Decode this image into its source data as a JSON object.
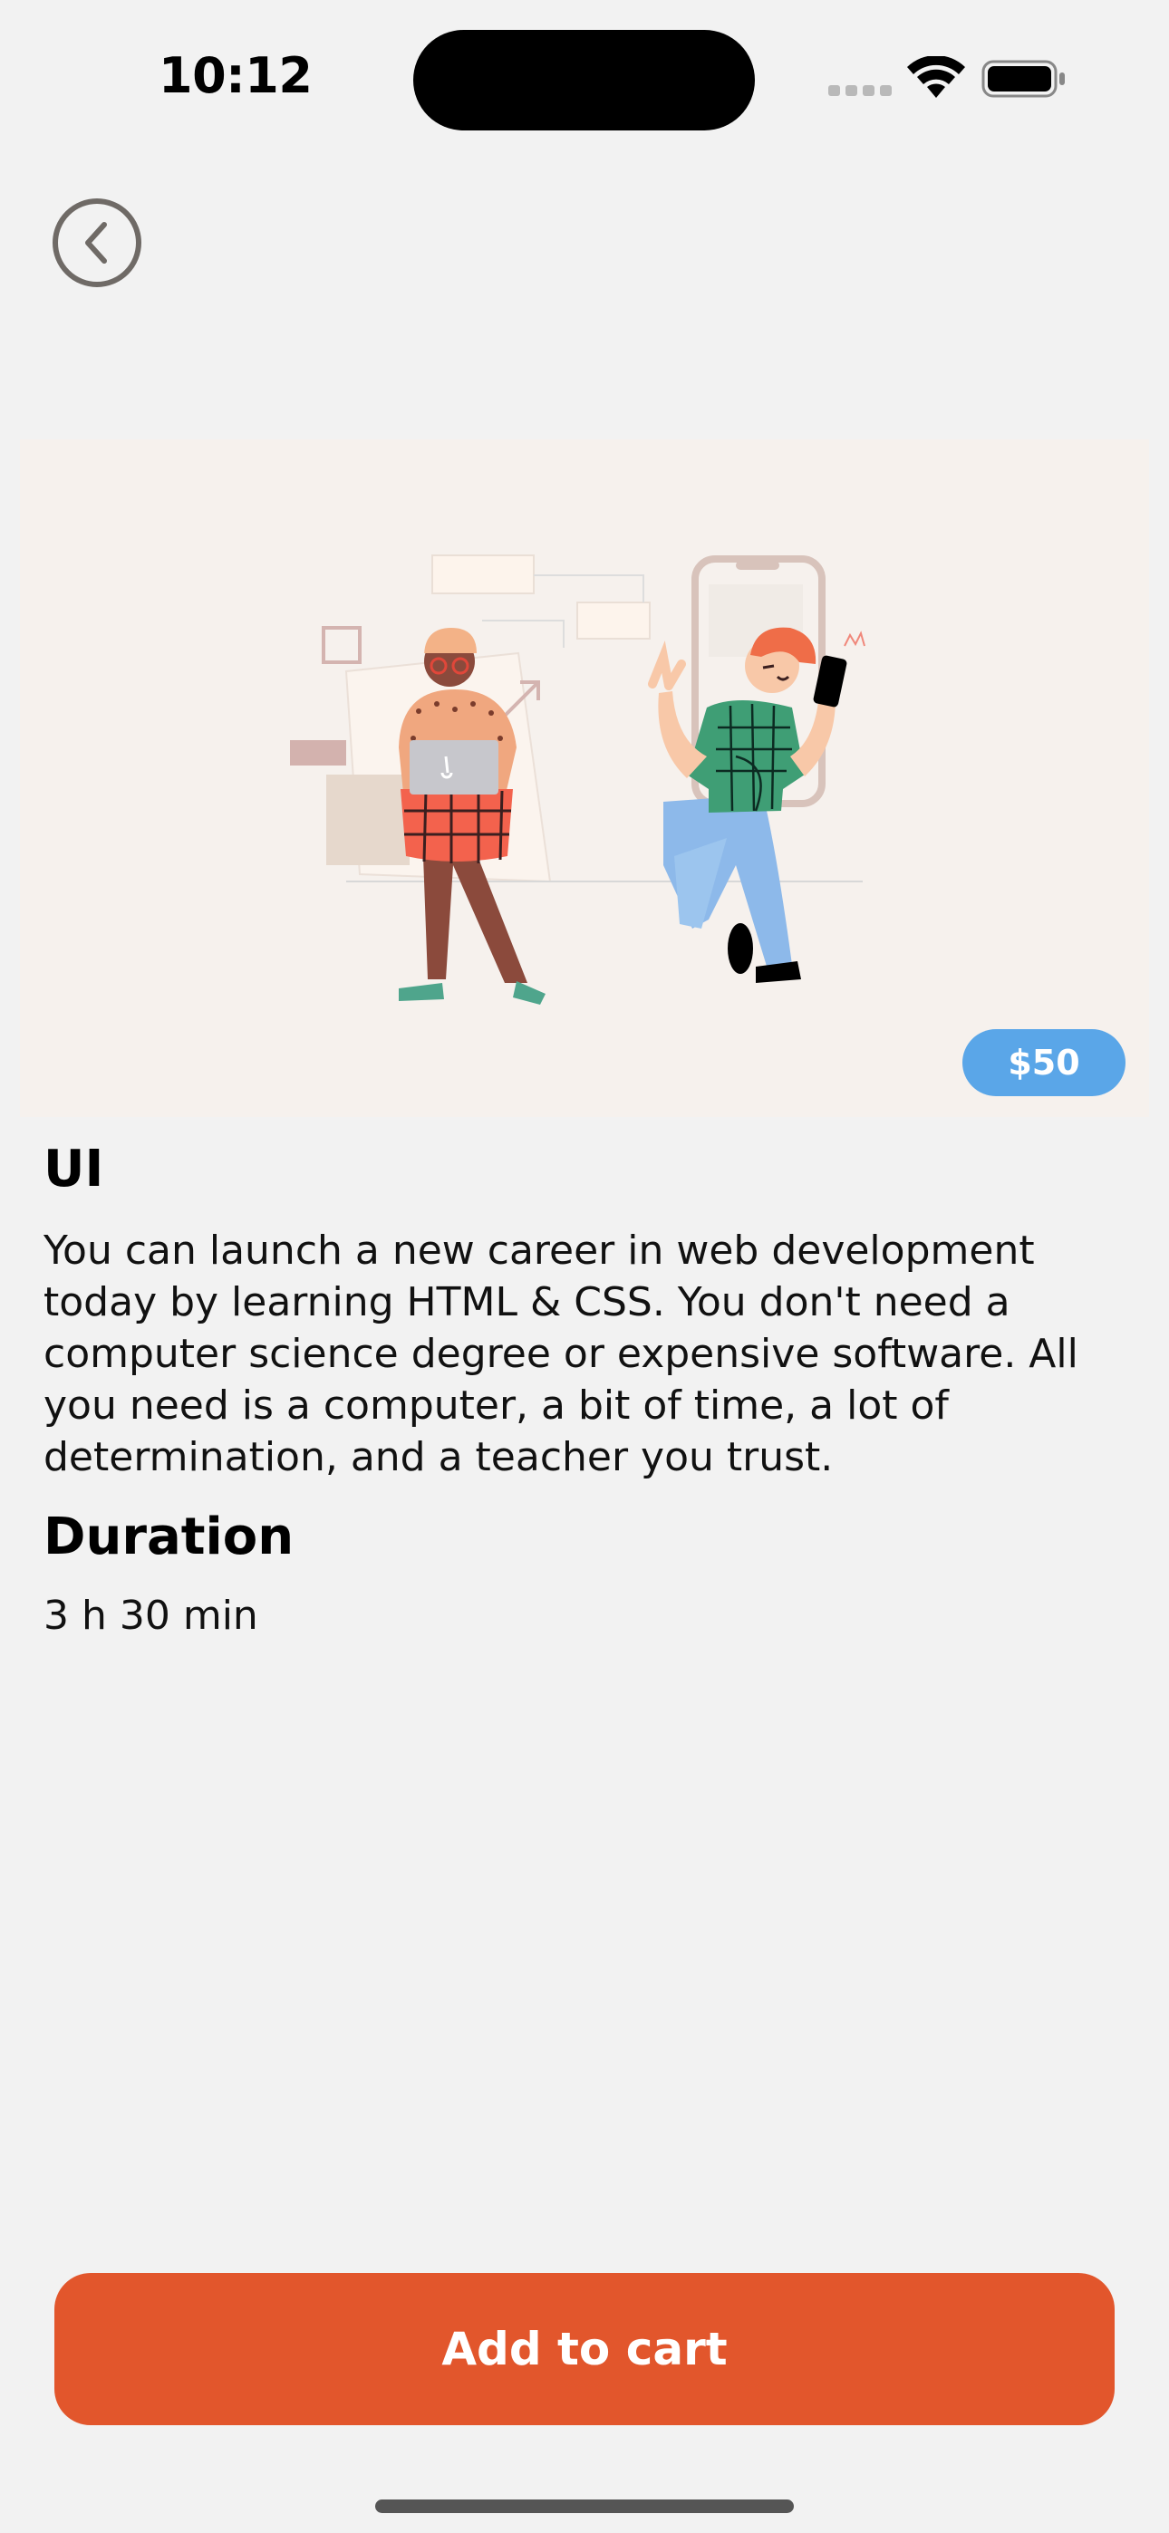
{
  "status_bar": {
    "time": "10:12",
    "icons": [
      "cellular-signal-icon",
      "wifi-icon",
      "battery-icon"
    ]
  },
  "navigation": {
    "back_icon": "chevron-left-icon"
  },
  "hero": {
    "illustration": "two-people-learning-illustration",
    "price": "$50",
    "price_color": "#5aa6e8"
  },
  "course": {
    "title": "UI",
    "description": "You can launch a new career in web development today by learning HTML & CSS. You don't need a computer science degree or expensive software. All you need is a computer, a bit of time, a lot of determination, and a teacher you trust.",
    "duration_heading": "Duration",
    "duration_value": "3 h 30 min"
  },
  "actions": {
    "add_to_cart_label": "Add to cart",
    "add_to_cart_color": "#e2562c"
  }
}
